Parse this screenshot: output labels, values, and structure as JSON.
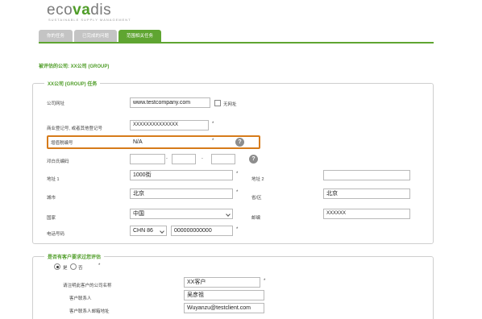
{
  "logo": {
    "brand": "ecovadis",
    "tagline": "SUSTAINABLE SUPPLY MANAGEMENT"
  },
  "tabs": [
    {
      "label": "你的任务"
    },
    {
      "label": "已完成的问题"
    },
    {
      "label": "范围相关任务"
    }
  ],
  "page_title": "被评估的公司: XX公司 (GROUP)",
  "section1": {
    "title": "XX公司 (GROUP) 任务",
    "website_label": "公司网址",
    "website_value": "www.testcompany.com",
    "no_website_label": "无网址",
    "reg_label": "商业登记号, 或者其他登记号",
    "reg_value": "XXXXXXXXXXXXXX",
    "tax_label": "增值税编号",
    "tax_value": "N/A",
    "duns_label": "邓白氏编码",
    "addr1_label": "地址 1",
    "addr1_value": "1000街",
    "addr2_label": "地址 2",
    "addr2_value": "",
    "city_label": "城市",
    "city_value": "北京",
    "province_label": "省/区",
    "province_value": "北京",
    "country_label": "国家",
    "country_value": "中国",
    "zip_label": "邮编",
    "zip_value": "XXXXXX",
    "phone_label": "电话号码",
    "phone_code": "CHN 86",
    "phone_value": "000000000000",
    "required": "*",
    "help": "?"
  },
  "section2": {
    "title": "是否有客户要求过您评估",
    "yes_label": "是",
    "no_label": "否",
    "client_name_label": "请注明此客户的公司名称",
    "client_name_value": "XX客户",
    "contact_label": "客户联系人",
    "contact_value": "吴彦祖",
    "email_label": "客户联系人邮箱地址",
    "email_value": "Wuyanzu@testclient.com",
    "required": "*"
  },
  "colors": {
    "brand_green": "#5fa531",
    "highlight_orange": "#d67b1a"
  }
}
